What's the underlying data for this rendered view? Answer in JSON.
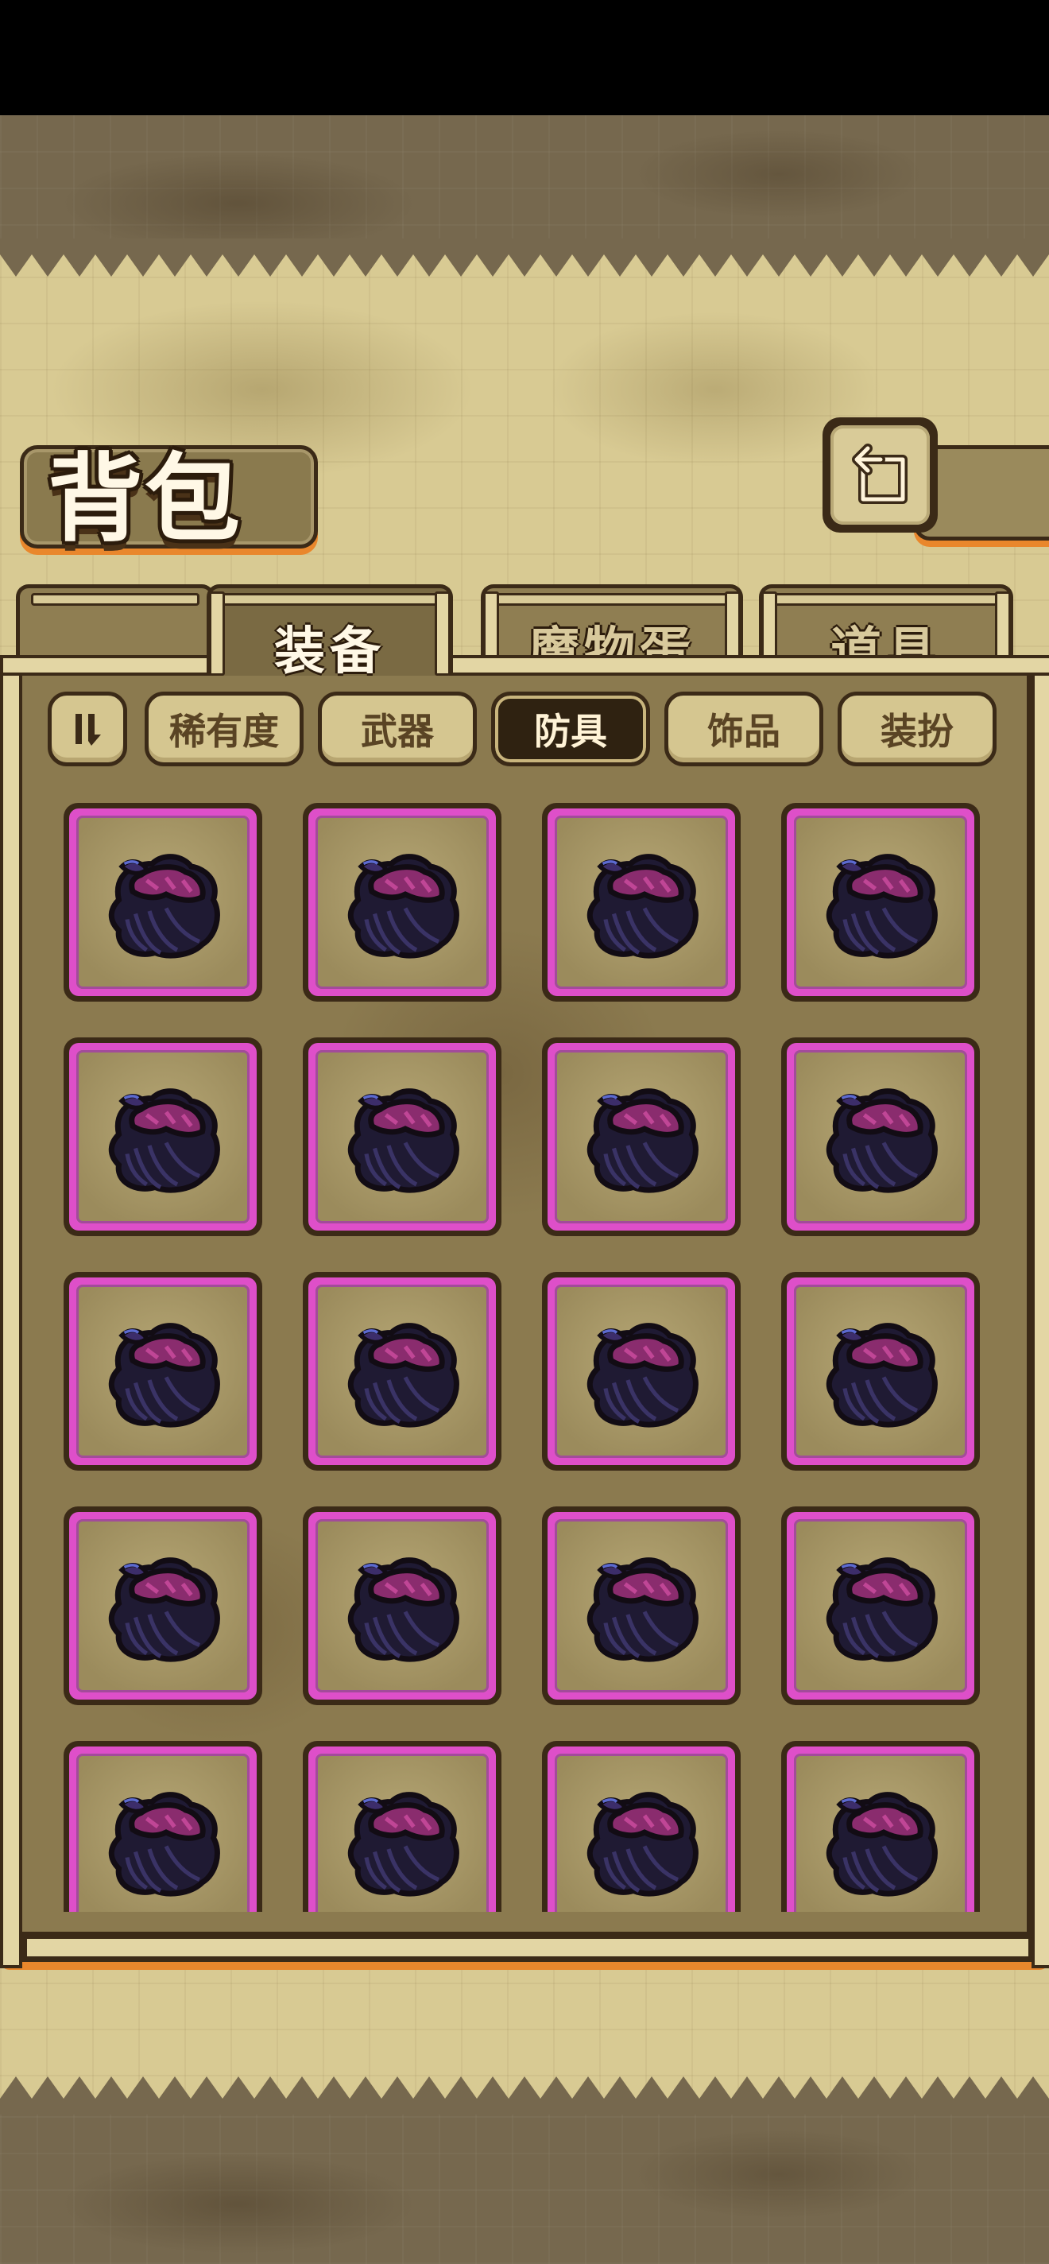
{
  "header": {
    "title": "背包"
  },
  "tabs": [
    {
      "label": "装备",
      "active": true
    },
    {
      "label": "魔物蛋",
      "active": false
    },
    {
      "label": "道具",
      "active": false
    }
  ],
  "filters": {
    "sort_icon": "sort-toggle-icon",
    "items": [
      {
        "label": "稀有度",
        "active": false
      },
      {
        "label": "武器",
        "active": false
      },
      {
        "label": "防具",
        "active": true
      },
      {
        "label": "饰品",
        "active": false
      },
      {
        "label": "装扮",
        "active": false
      }
    ]
  },
  "inventory": {
    "item_icon": "purple-feather-cloak-icon",
    "rarity_color": "#de4fc9",
    "slot_count": 20
  },
  "colors": {
    "frame": "#3b2a17",
    "accent_orange": "#e9872c",
    "parchment": "#d8ca93",
    "panel": "#8b7a4f"
  }
}
